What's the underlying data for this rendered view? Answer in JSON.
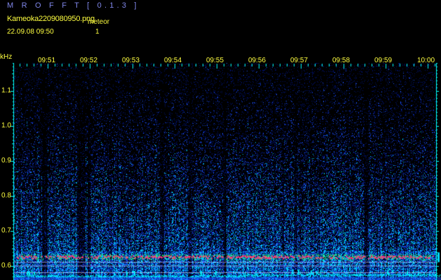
{
  "app": {
    "title": "M R O F F T [ 0.1.3 ]"
  },
  "file": {
    "name": "Kameoka2209080950.png",
    "timestamp": "22.09.08 09:50"
  },
  "meteor": {
    "label": "meteor",
    "count": "1"
  },
  "axis": {
    "unit": "kHz",
    "time_labels": [
      "09:51",
      "09:52",
      "09:53",
      "09:54",
      "09:55",
      "09:56",
      "09:57",
      "09:58",
      "09:59",
      "10:00"
    ],
    "freq_labels": [
      "1.1",
      "1.0",
      "0.9",
      "0.8",
      "0.7",
      "0.6"
    ]
  },
  "colors": {
    "background": "#000000",
    "title": "#7f86e8",
    "text": "#ffff40",
    "axis": "#00ffff",
    "noise_dark": "#00106a",
    "noise_mid": "#1e50ff",
    "noise_bright": "#00d7ff",
    "signal_green": "#30ff60",
    "signal_hot": "#ff3c78",
    "ref_line": "#dcdcff"
  }
}
